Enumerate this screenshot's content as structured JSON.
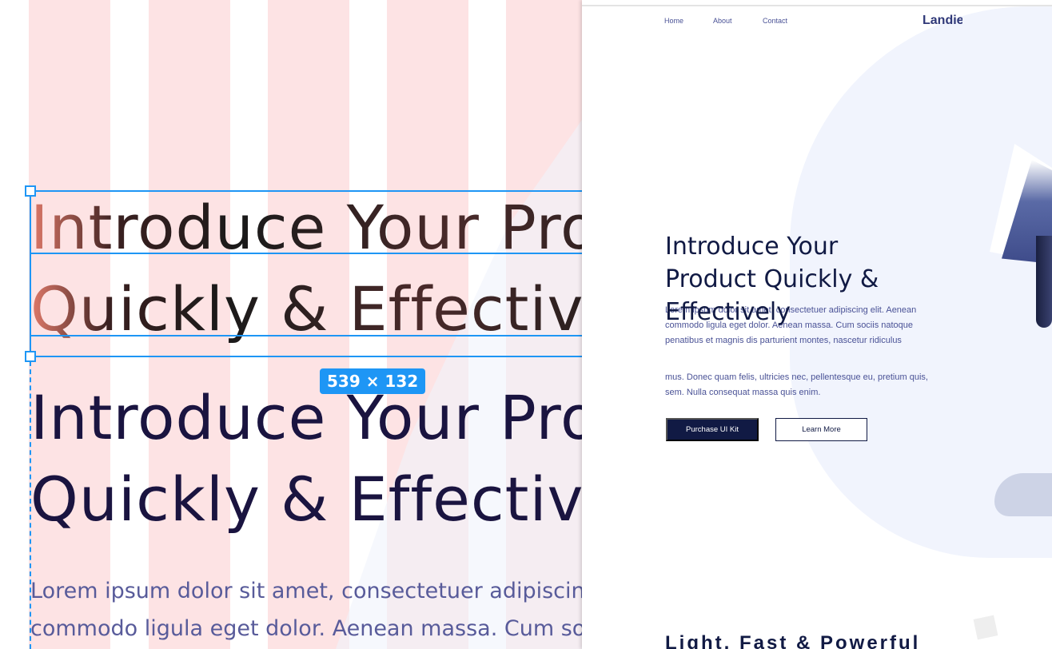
{
  "canvas": {
    "heading_line1": "Introduce Your Product",
    "heading_line2": "Quickly & Effectively",
    "selection_size": "539 × 132",
    "body_line1": "Lorem ipsum dolor sit amet, consectetuer adipiscing elit.",
    "body_line2": "commodo ligula eget dolor. Aenean massa. Cum sociis"
  },
  "preview": {
    "nav": [
      "Home",
      "About",
      "Contact"
    ],
    "logo": "Landie",
    "heading": "Introduce Your Product Quickly & Effectively",
    "paragraph1": "Lorem ipsum dolor sit amet, consectetuer adipiscing elit. Aenean commodo ligula eget dolor. Aenean massa. Cum sociis natoque penatibus et magnis dis parturient montes, nascetur ridiculus",
    "paragraph2": "mus. Donec quam felis, ultricies nec, pellentesque eu, pretium quis, sem. Nulla consequat massa quis enim.",
    "purchase_button": "Purchase UI Kit",
    "learn_more_button": "Learn More",
    "section_heading": "Light, Fast & Powerful"
  }
}
